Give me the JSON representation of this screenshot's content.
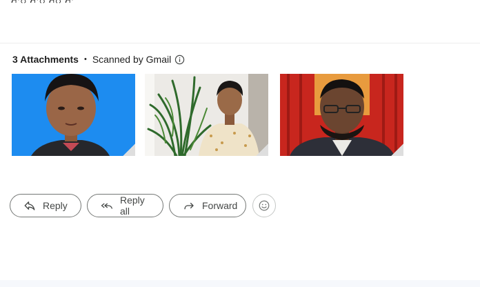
{
  "email": {
    "cut_off_line": "ਮਾਨ ਮਾਨ ਮਨ ਮਾ"
  },
  "attachments": {
    "count_label": "3 Attachments",
    "separator": "•",
    "scan_label": "Scanned by Gmail",
    "info_icon": "info-icon",
    "items": [
      {
        "kind": "photo",
        "background": "#1d8cf0"
      },
      {
        "kind": "photo",
        "background": "#eceae6"
      },
      {
        "kind": "photo",
        "background": "#c8261e"
      }
    ]
  },
  "actions": {
    "reply_label": "Reply",
    "reply_all_label": "Reply all",
    "forward_label": "Forward",
    "emoji_icon": "smiley-icon"
  },
  "colors": {
    "text": "#1f1f1f",
    "button_text": "#444746",
    "button_border": "#747775",
    "bottom_bar": "#f6f8fc"
  }
}
